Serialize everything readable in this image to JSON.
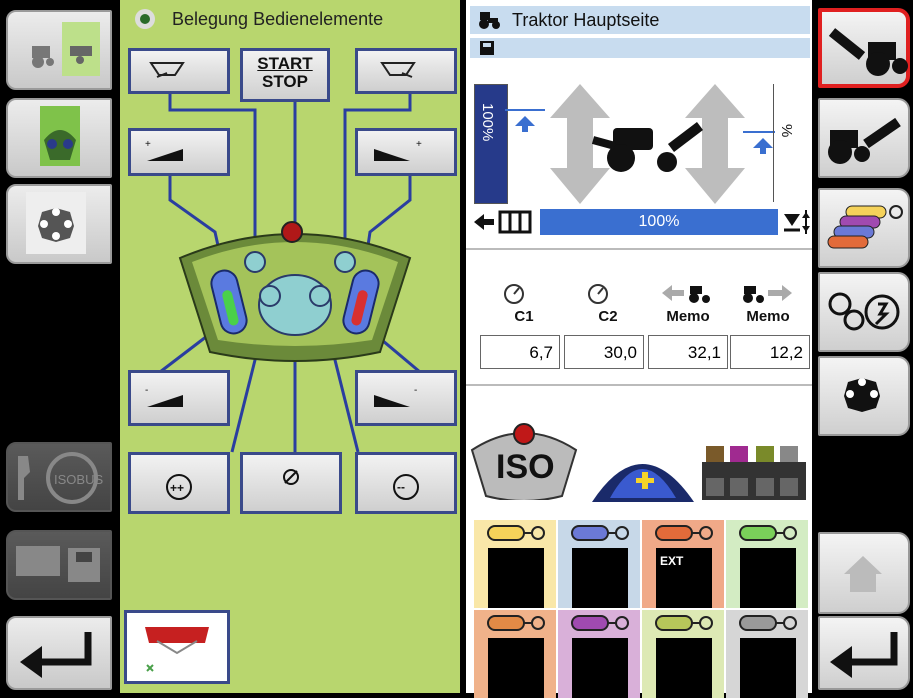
{
  "green_panel": {
    "title": "Belegung Bedienelemente",
    "start_label": "START",
    "stop_label": "STOP"
  },
  "tractor_panel": {
    "title": "Traktor Hauptseite",
    "lift_level_left": "100%",
    "lift_level_right": "%",
    "bottom_bar": "100%",
    "headers": {
      "c1": "C1",
      "c2": "C2",
      "memo1": "Memo",
      "memo2": "Memo"
    },
    "values": {
      "c1": "6,7",
      "c2": "30,0",
      "memo1": "32,1",
      "memo2": "12,2"
    },
    "iso_label": "ISO",
    "ext_label": "EXT"
  },
  "colors": {
    "green_bg": "#b8d66e",
    "button_border": "#3a4a8a",
    "bar_fill": "#3a6fd0",
    "active_border": "#e02020"
  },
  "tiles": [
    {
      "color": "#f5d25a",
      "bg": "#f9e7a8"
    },
    {
      "color": "#6b79d6",
      "bg": "#c7d8e8"
    },
    {
      "color": "#e26b3a",
      "bg": "#f0a988"
    },
    {
      "color": "#7ad05a",
      "bg": "#d3ecc3"
    },
    {
      "color": "#e28a46",
      "bg": "#f0b28a"
    },
    {
      "color": "#a04ab0",
      "bg": "#d9b0d9"
    },
    {
      "color": "#b7c75a",
      "bg": "#dde9b4"
    },
    {
      "color": "#9a9a9a",
      "bg": "#d6d6d6"
    }
  ]
}
